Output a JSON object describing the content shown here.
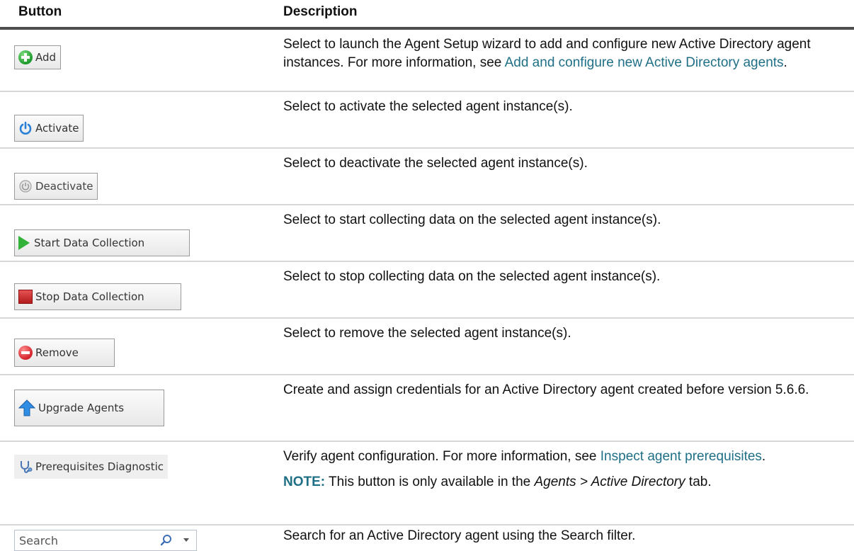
{
  "headers": {
    "button": "Button",
    "description": "Description"
  },
  "rows": [
    {
      "button_label": "Add",
      "icon": "add-circle-icon",
      "description_before": "Select to launch the Agent Setup wizard to add and configure new Active Directory agent instances. For more information, see ",
      "link_text": "Add and configure new Active Directory agents",
      "description_after": "."
    },
    {
      "button_label": "Activate",
      "icon": "power-icon",
      "description": "Select to activate the selected agent instance(s)."
    },
    {
      "button_label": "Deactivate",
      "icon": "power-disabled-icon",
      "description": "Select to deactivate the selected agent instance(s)."
    },
    {
      "button_label": "Start Data Collection",
      "icon": "play-icon",
      "description": "Select to start collecting data on the selected agent instance(s)."
    },
    {
      "button_label": "Stop Data Collection",
      "icon": "stop-icon",
      "description": "Select to stop collecting data on the selected agent instance(s)."
    },
    {
      "button_label": "Remove",
      "icon": "remove-circle-icon",
      "description": "Select to remove the selected agent instance(s)."
    },
    {
      "button_label": "Upgrade Agents",
      "icon": "arrow-up-icon",
      "description": "Create and assign credentials for an Active Directory agent created before version 5.6.6."
    },
    {
      "button_label": "Prerequisites Diagnostic",
      "icon": "stethoscope-icon",
      "description_before": "Verify agent configuration. For more information, see ",
      "link_text": "Inspect agent prerequisites",
      "description_after": ".",
      "note_label": "NOTE:",
      "note_text_1": " This button is only available in the ",
      "note_italic": "Agents > Active Directory",
      "note_text_2": " tab."
    },
    {
      "placeholder": "Search",
      "icon": "search-icon",
      "description": "Search for an Active Directory agent using the Search filter."
    }
  ],
  "colors": {
    "link": "#1f6f86",
    "header_rule": "#4d4d4d",
    "row_rule": "#d7d7d7"
  }
}
